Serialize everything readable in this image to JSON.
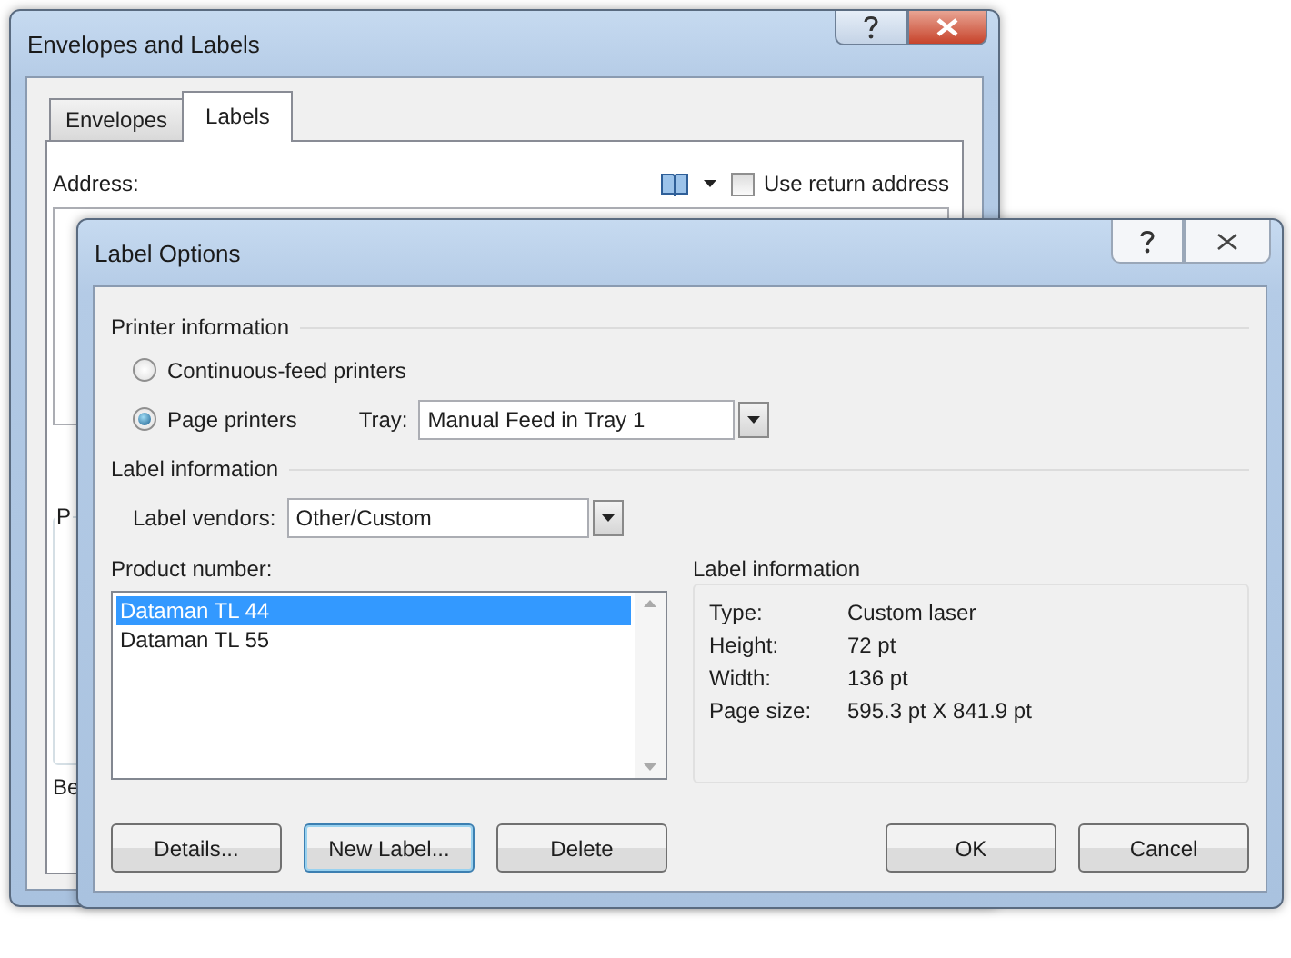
{
  "back_window": {
    "title": "Envelopes and Labels",
    "tabs": [
      {
        "label": "Envelopes",
        "selected": false
      },
      {
        "label": "Labels",
        "selected": true
      }
    ],
    "address_label": "Address:",
    "use_return_address": {
      "label": "Use return address",
      "checked": false
    },
    "group_legend": "P",
    "bottom_label": "Be"
  },
  "dialog": {
    "title": "Label Options",
    "printer_information": {
      "heading": "Printer information",
      "options": [
        {
          "label": "Continuous-feed printers",
          "selected": false
        },
        {
          "label": "Page printers",
          "selected": true
        }
      ],
      "tray_label": "Tray:",
      "tray_value": "Manual Feed in Tray 1"
    },
    "label_information": {
      "heading": "Label information",
      "vendors_label": "Label vendors:",
      "vendors_value": "Other/Custom"
    },
    "product_number": {
      "label": "Product number:",
      "items": [
        {
          "label": "Dataman TL 44",
          "selected": true
        },
        {
          "label": "Dataman TL 55",
          "selected": false
        }
      ]
    },
    "details": {
      "heading": "Label information",
      "rows": [
        {
          "key": "Type:",
          "value": "Custom laser"
        },
        {
          "key": "Height:",
          "value": "72 pt"
        },
        {
          "key": "Width:",
          "value": "136 pt"
        },
        {
          "key": "Page size:",
          "value": "595.3 pt X 841.9 pt"
        }
      ]
    },
    "buttons": [
      {
        "label": "Details...",
        "focused": false
      },
      {
        "label": "New Label...",
        "focused": true
      },
      {
        "label": "Delete",
        "focused": false
      },
      {
        "label": "OK",
        "focused": false
      },
      {
        "label": "Cancel",
        "focused": false
      }
    ]
  }
}
